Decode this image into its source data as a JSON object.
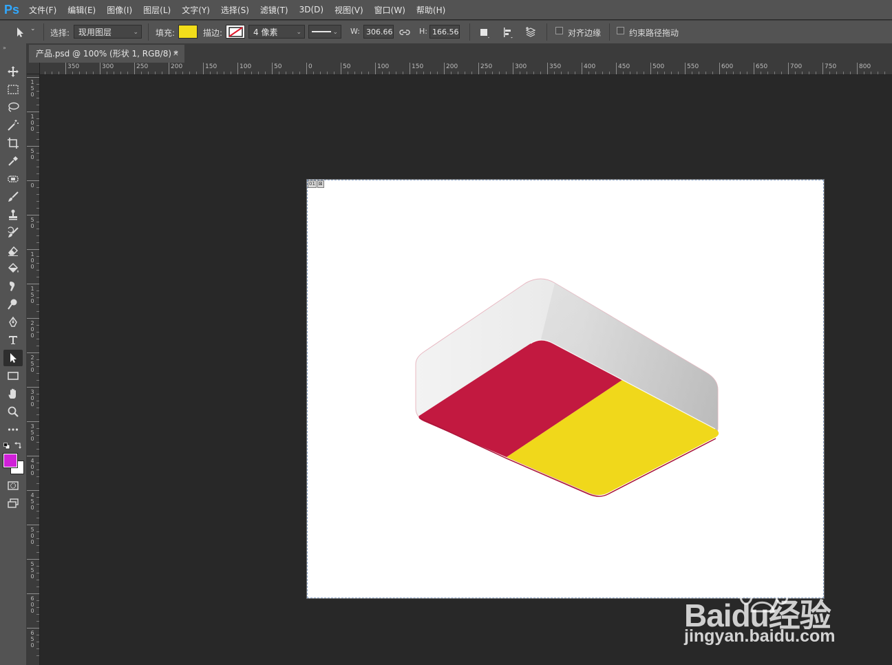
{
  "app": {
    "logo": "Ps"
  },
  "menu": [
    "文件(F)",
    "编辑(E)",
    "图像(I)",
    "图层(L)",
    "文字(Y)",
    "选择(S)",
    "滤镜(T)",
    "3D(D)",
    "视图(V)",
    "窗口(W)",
    "帮助(H)"
  ],
  "options": {
    "select_label": "选择:",
    "select_value": "现用图层",
    "fill_label": "填充:",
    "fill_color": "#f2dd1a",
    "stroke_label": "描边:",
    "stroke_width": "4 像素",
    "w_label": "W:",
    "w_value": "306.66 f",
    "h_label": "H:",
    "h_value": "166.56 f",
    "align_edges_label": "对齐边缘",
    "constrain_path_label": "约束路径拖动"
  },
  "document": {
    "tab_title": "产品.psd @ 100% (形状 1, RGB/8) *",
    "close": "×",
    "slice_number": "01"
  },
  "ruler_top": [
    "350",
    "300",
    "250",
    "200",
    "150",
    "100",
    "50",
    "0",
    "50",
    "100",
    "150",
    "200",
    "250",
    "300",
    "350",
    "400",
    "450",
    "500",
    "550",
    "600",
    "650",
    "700",
    "750",
    "800"
  ],
  "ruler_left": [
    "150",
    "100",
    "50",
    "0",
    "50",
    "100",
    "150",
    "200",
    "250",
    "300",
    "350",
    "400",
    "450",
    "500",
    "550",
    "600",
    "650"
  ],
  "colors": {
    "foreground": "#d020d8",
    "background": "#ffffff",
    "panel_red": "#c21940",
    "panel_yellow": "#f0d81b",
    "lamp_body": "#e6e6e6"
  },
  "watermark": {
    "brand": "Baidu经验",
    "url": "jingyan.baidu.com"
  }
}
